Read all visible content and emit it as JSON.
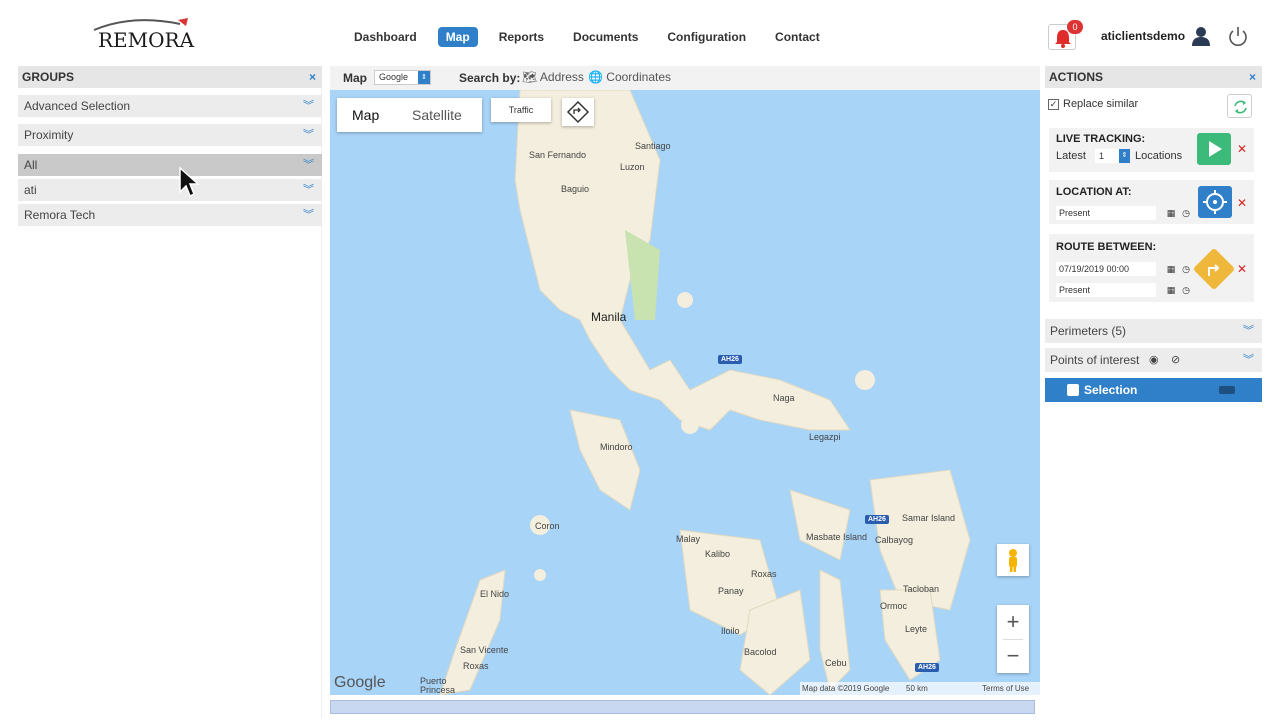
{
  "header": {
    "logo_text": "REMORA",
    "nav": [
      "Dashboard",
      "Map",
      "Reports",
      "Documents",
      "Configuration",
      "Contact"
    ],
    "active_nav": "Map",
    "notification_count": "0",
    "username": "aticlientsdemo"
  },
  "groups": {
    "title": "GROUPS",
    "close": "×",
    "rows": [
      "Advanced Selection",
      "Proximity",
      "All",
      "ati",
      "Remora Tech"
    ]
  },
  "map_toolbar": {
    "map_label": "Map",
    "provider": "Google",
    "search_by": "Search by:",
    "address": "Address",
    "coordinates": "Coordinates"
  },
  "map": {
    "type_map": "Map",
    "type_satellite": "Satellite",
    "traffic": "Traffic",
    "labels": {
      "san_fernando": "San Fernando",
      "santiago": "Santiago",
      "luzon": "Luzon",
      "baguio": "Baguio",
      "manila": "Manila",
      "naga": "Naga",
      "legazpi": "Legazpi",
      "mindoro": "Mindoro",
      "samar": "Samar Island",
      "masbate": "Masbate Island",
      "calbayog": "Calbayog",
      "coron": "Coron",
      "malay": "Malay",
      "kalibo": "Kalibo",
      "roxas": "Roxas",
      "panay": "Panay",
      "tacloban": "Tacloban",
      "ormoc": "Ormoc",
      "leyte": "Leyte",
      "el_nido": "El Nido",
      "iloilo": "Iloilo",
      "bacolod": "Bacolod",
      "cebu": "Cebu",
      "san_vicente": "San Vicente",
      "roxas2": "Roxas",
      "puerto_princesa": "Puerto Princesa",
      "ah26": "AH26"
    },
    "zoom_in": "+",
    "zoom_out": "−",
    "google": "Google",
    "attribution": "Map data ©2019 Google",
    "scale": "50 km",
    "terms": "Terms of Use"
  },
  "actions": {
    "title": "ACTIONS",
    "close": "×",
    "replace_similar": "Replace similar",
    "live_tracking": {
      "title": "LIVE TRACKING:",
      "latest": "Latest",
      "count": "1",
      "locations": "Locations"
    },
    "location_at": {
      "title": "LOCATION AT:",
      "value": "Present"
    },
    "route_between": {
      "title": "ROUTE BETWEEN:",
      "from": "07/19/2019 00:00",
      "to": "Present"
    },
    "perimeters": "Perimeters (5)",
    "points_of_interest": "Points of interest",
    "selection": "Selection"
  },
  "colors": {
    "accent": "#2f80c9",
    "play_green": "#3cba7a",
    "locate_blue": "#2f80c9",
    "route_yellow": "#f0b83a",
    "water": "#a8d4f8",
    "land": "#f5f1e6"
  }
}
